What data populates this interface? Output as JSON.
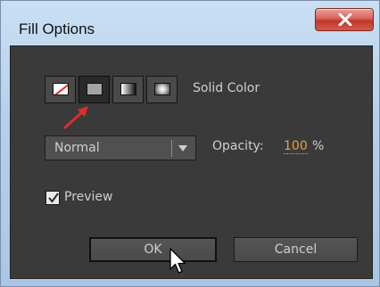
{
  "window": {
    "title": "Fill Options",
    "close_glyph": "X",
    "icons": {
      "close": "close-icon"
    }
  },
  "fill_types": {
    "selected_label": "Solid Color",
    "options": [
      "no-fill",
      "solid-color",
      "linear-gradient",
      "radial-gradient"
    ],
    "selected_index": 1,
    "annotation_color": "#d9302a"
  },
  "blend": {
    "mode": "Normal",
    "icons": {
      "dropdown": "chevron-down-icon"
    }
  },
  "opacity": {
    "label": "Opacity:",
    "value": "100",
    "unit": "%",
    "value_color": "#e8a53b"
  },
  "preview": {
    "label": "Preview",
    "checked": true
  },
  "buttons": {
    "ok": "OK",
    "cancel": "Cancel"
  },
  "colors": {
    "panel_bg": "#3a3a3a",
    "text": "#cfcfcf"
  }
}
